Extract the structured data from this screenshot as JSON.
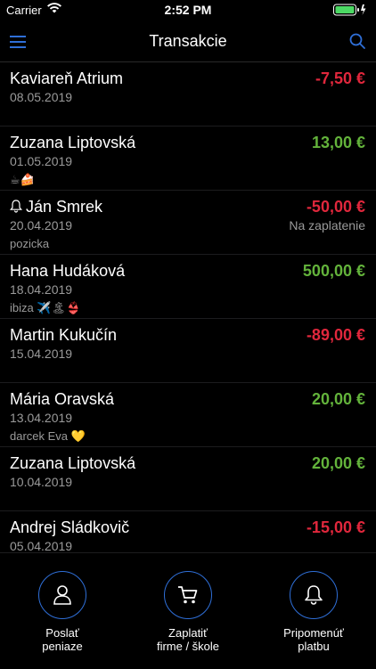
{
  "status": {
    "carrier": "Carrier",
    "time": "2:52 PM"
  },
  "nav": {
    "title": "Transakcie"
  },
  "transactions": [
    {
      "name": "Kaviareň Atrium",
      "date": "08.05.2019",
      "amount": "-7,50 €",
      "type": "neg",
      "note": "",
      "status": ""
    },
    {
      "name": "Zuzana Liptovská",
      "date": "01.05.2019",
      "amount": "13,00 €",
      "type": "pos",
      "note": "☕🍰",
      "status": ""
    },
    {
      "name": "Ján Smrek",
      "date": "20.04.2019",
      "amount": "-50,00 €",
      "type": "neg",
      "note": "pozicka",
      "status": "Na zaplatenie",
      "bell": true
    },
    {
      "name": "Hana Hudáková",
      "date": "18.04.2019",
      "amount": "500,00 €",
      "type": "pos",
      "note": "ibiza ✈️🏝👙",
      "status": ""
    },
    {
      "name": "Martin Kukučín",
      "date": "15.04.2019",
      "amount": "-89,00 €",
      "type": "neg",
      "note": "",
      "status": ""
    },
    {
      "name": "Mária Oravská",
      "date": "13.04.2019",
      "amount": "20,00 €",
      "type": "pos",
      "note": "darcek Eva 💛",
      "status": ""
    },
    {
      "name": "Zuzana Liptovská",
      "date": "10.04.2019",
      "amount": "20,00 €",
      "type": "pos",
      "note": "",
      "status": ""
    },
    {
      "name": "Andrej Sládkovič",
      "date": "05.04.2019",
      "amount": "-15,00 €",
      "type": "neg",
      "note": "",
      "status": ""
    }
  ],
  "actions": [
    {
      "line1": "Poslať",
      "line2": "peniaze",
      "icon": "person-icon"
    },
    {
      "line1": "Zaplatiť",
      "line2": "firme / škole",
      "icon": "cart-icon"
    },
    {
      "line1": "Pripomenúť",
      "line2": "platbu",
      "icon": "bell-icon"
    }
  ],
  "colors": {
    "negative": "#e0273c",
    "positive": "#63b33b",
    "accent": "#2f6fd8"
  }
}
